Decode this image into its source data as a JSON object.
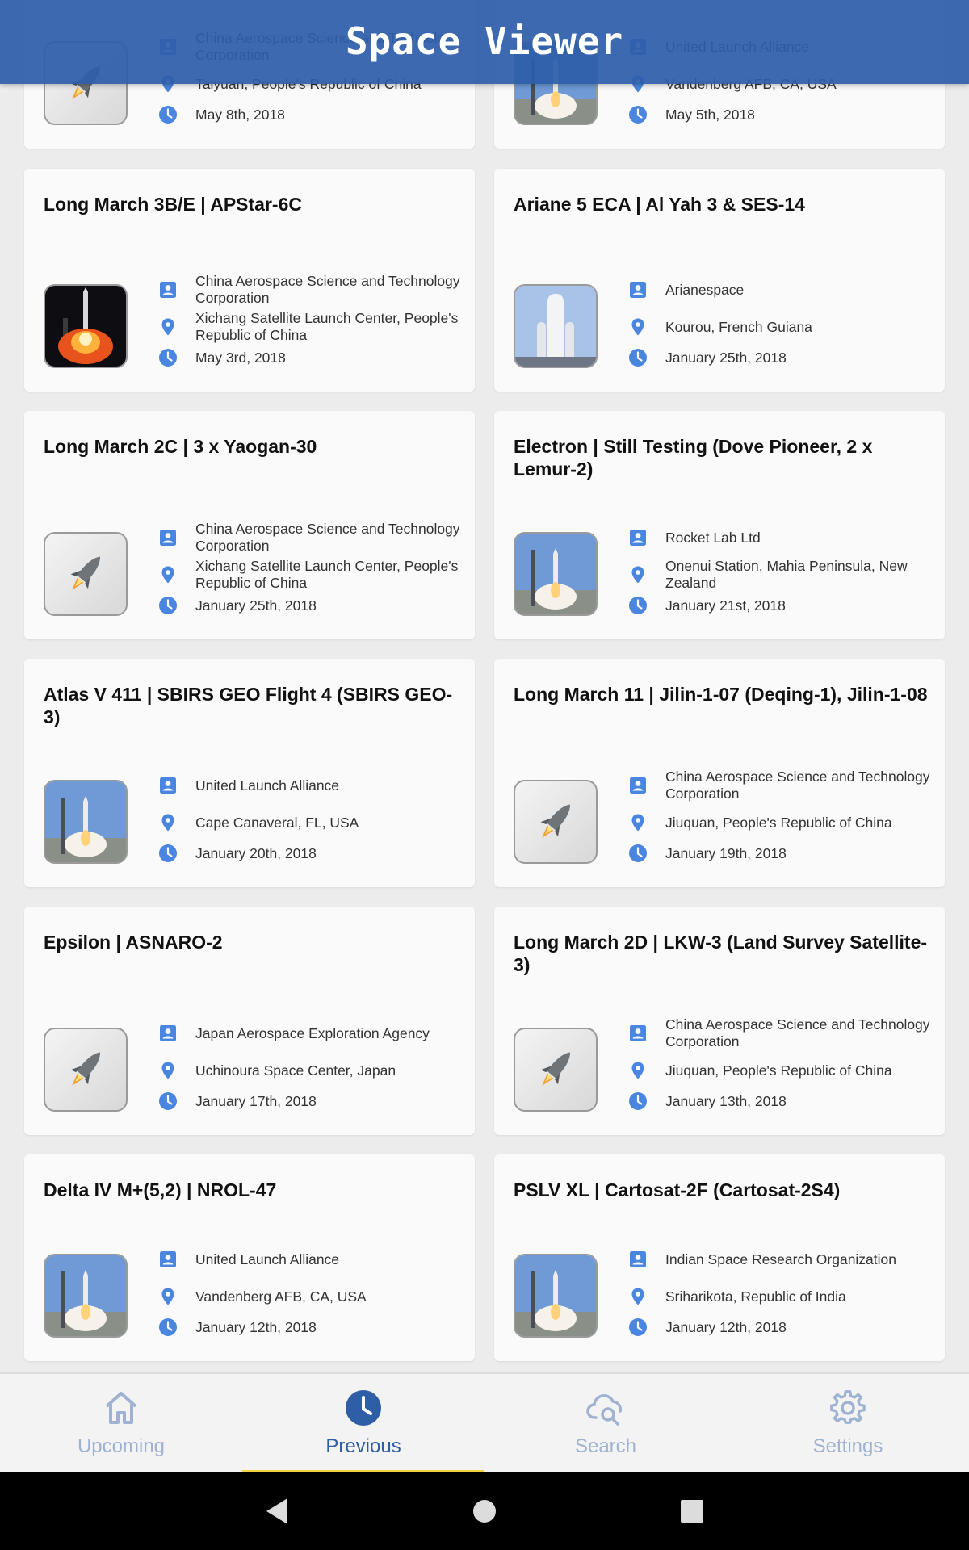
{
  "app": {
    "title": "Space Viewer"
  },
  "colors": {
    "appbar": "#2e5ea6",
    "info_icon": "#4a86e0",
    "nav_active": "#2e5ea6",
    "nav_inactive": "#9fb2d2",
    "nav_indicator": "#f3d33b"
  },
  "launches": [
    {
      "title": "",
      "agency": "China Aerospace Science and Technology Corporation",
      "location": "Taiyuan, People's Republic of China",
      "date": "May 8th, 2018",
      "image": "placeholder-rocket-icon"
    },
    {
      "title": "",
      "agency": "United Launch Alliance",
      "location": "Vandenberg AFB, CA, USA",
      "date": "May 5th, 2018",
      "image": "launch-photo"
    },
    {
      "title": "Long March 3B/E | APStar-6C",
      "agency": "China Aerospace Science and Technology Corporation",
      "location": "Xichang Satellite Launch Center, People's Republic of China",
      "date": "May 3rd, 2018",
      "image": "launch-photo-night"
    },
    {
      "title": "Ariane 5 ECA | Al Yah 3 & SES-14",
      "agency": "Arianespace",
      "location": "Kourou, French Guiana",
      "date": "January 25th, 2018",
      "image": "rocket-photo"
    },
    {
      "title": "Long March 2C | 3 x Yaogan-30",
      "agency": "China Aerospace Science and Technology Corporation",
      "location": "Xichang Satellite Launch Center, People's Republic of China",
      "date": "January 25th, 2018",
      "image": "placeholder-rocket-icon"
    },
    {
      "title": "Electron  | Still Testing (Dove Pioneer, 2 x Lemur-2)",
      "agency": "Rocket Lab Ltd",
      "location": "Onenui Station, Mahia Peninsula, New Zealand",
      "date": "January 21st, 2018",
      "image": "launch-photo"
    },
    {
      "title": "Atlas V 411 | SBIRS GEO Flight 4 (SBIRS GEO-3)",
      "agency": "United Launch Alliance",
      "location": "Cape Canaveral, FL, USA",
      "date": "January 20th, 2018",
      "image": "launch-photo"
    },
    {
      "title": "Long March 11 | Jilin-1-07 (Deqing-1), Jilin-1-08",
      "agency": "China Aerospace Science and Technology Corporation",
      "location": "Jiuquan, People's Republic of China",
      "date": "January 19th, 2018",
      "image": "placeholder-rocket-icon"
    },
    {
      "title": "Epsilon  | ASNARO-2",
      "agency": "Japan Aerospace Exploration Agency",
      "location": "Uchinoura Space Center, Japan",
      "date": "January 17th, 2018",
      "image": "placeholder-rocket-icon"
    },
    {
      "title": "Long March 2D | LKW-3 (Land Survey Satellite-3)",
      "agency": "China Aerospace Science and Technology Corporation",
      "location": "Jiuquan, People's Republic of China",
      "date": "January 13th, 2018",
      "image": "placeholder-rocket-icon"
    },
    {
      "title": "Delta IV M+(5,2) | NROL-47",
      "agency": "United Launch Alliance",
      "location": "Vandenberg AFB, CA, USA",
      "date": "January 12th, 2018",
      "image": "launch-photo"
    },
    {
      "title": "PSLV XL | Cartosat-2F (Cartosat-2S4)",
      "agency": "Indian Space Research Organization",
      "location": "Sriharikota, Republic of India",
      "date": "January 12th, 2018",
      "image": "launch-photo"
    }
  ],
  "bottom_nav": {
    "active": "Previous",
    "items": [
      {
        "label": "Upcoming",
        "icon": "home-icon"
      },
      {
        "label": "Previous",
        "icon": "clock-icon"
      },
      {
        "label": "Search",
        "icon": "cloud-search-icon"
      },
      {
        "label": "Settings",
        "icon": "gear-icon"
      }
    ]
  },
  "system_nav": {
    "buttons": [
      "back-icon",
      "home-circle-icon",
      "recents-square-icon"
    ]
  }
}
